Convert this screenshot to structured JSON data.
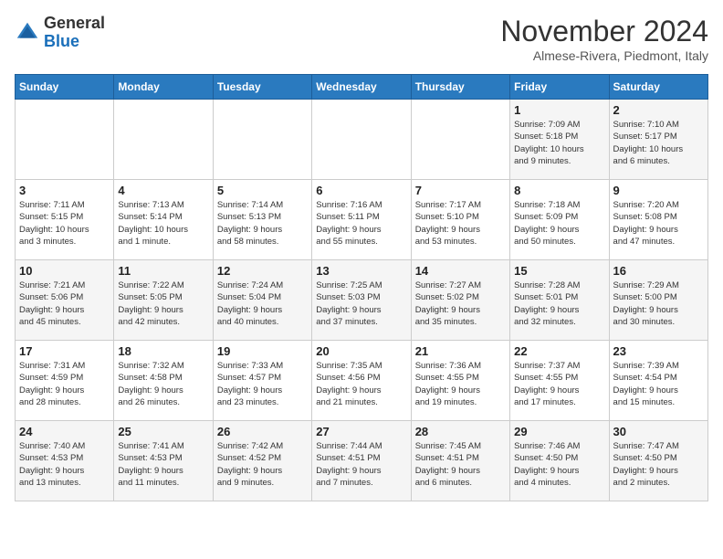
{
  "header": {
    "logo_general": "General",
    "logo_blue": "Blue",
    "month_title": "November 2024",
    "location": "Almese-Rivera, Piedmont, Italy"
  },
  "days_of_week": [
    "Sunday",
    "Monday",
    "Tuesday",
    "Wednesday",
    "Thursday",
    "Friday",
    "Saturday"
  ],
  "weeks": [
    [
      {
        "day": "",
        "info": ""
      },
      {
        "day": "",
        "info": ""
      },
      {
        "day": "",
        "info": ""
      },
      {
        "day": "",
        "info": ""
      },
      {
        "day": "",
        "info": ""
      },
      {
        "day": "1",
        "info": "Sunrise: 7:09 AM\nSunset: 5:18 PM\nDaylight: 10 hours\nand 9 minutes."
      },
      {
        "day": "2",
        "info": "Sunrise: 7:10 AM\nSunset: 5:17 PM\nDaylight: 10 hours\nand 6 minutes."
      }
    ],
    [
      {
        "day": "3",
        "info": "Sunrise: 7:11 AM\nSunset: 5:15 PM\nDaylight: 10 hours\nand 3 minutes."
      },
      {
        "day": "4",
        "info": "Sunrise: 7:13 AM\nSunset: 5:14 PM\nDaylight: 10 hours\nand 1 minute."
      },
      {
        "day": "5",
        "info": "Sunrise: 7:14 AM\nSunset: 5:13 PM\nDaylight: 9 hours\nand 58 minutes."
      },
      {
        "day": "6",
        "info": "Sunrise: 7:16 AM\nSunset: 5:11 PM\nDaylight: 9 hours\nand 55 minutes."
      },
      {
        "day": "7",
        "info": "Sunrise: 7:17 AM\nSunset: 5:10 PM\nDaylight: 9 hours\nand 53 minutes."
      },
      {
        "day": "8",
        "info": "Sunrise: 7:18 AM\nSunset: 5:09 PM\nDaylight: 9 hours\nand 50 minutes."
      },
      {
        "day": "9",
        "info": "Sunrise: 7:20 AM\nSunset: 5:08 PM\nDaylight: 9 hours\nand 47 minutes."
      }
    ],
    [
      {
        "day": "10",
        "info": "Sunrise: 7:21 AM\nSunset: 5:06 PM\nDaylight: 9 hours\nand 45 minutes."
      },
      {
        "day": "11",
        "info": "Sunrise: 7:22 AM\nSunset: 5:05 PM\nDaylight: 9 hours\nand 42 minutes."
      },
      {
        "day": "12",
        "info": "Sunrise: 7:24 AM\nSunset: 5:04 PM\nDaylight: 9 hours\nand 40 minutes."
      },
      {
        "day": "13",
        "info": "Sunrise: 7:25 AM\nSunset: 5:03 PM\nDaylight: 9 hours\nand 37 minutes."
      },
      {
        "day": "14",
        "info": "Sunrise: 7:27 AM\nSunset: 5:02 PM\nDaylight: 9 hours\nand 35 minutes."
      },
      {
        "day": "15",
        "info": "Sunrise: 7:28 AM\nSunset: 5:01 PM\nDaylight: 9 hours\nand 32 minutes."
      },
      {
        "day": "16",
        "info": "Sunrise: 7:29 AM\nSunset: 5:00 PM\nDaylight: 9 hours\nand 30 minutes."
      }
    ],
    [
      {
        "day": "17",
        "info": "Sunrise: 7:31 AM\nSunset: 4:59 PM\nDaylight: 9 hours\nand 28 minutes."
      },
      {
        "day": "18",
        "info": "Sunrise: 7:32 AM\nSunset: 4:58 PM\nDaylight: 9 hours\nand 26 minutes."
      },
      {
        "day": "19",
        "info": "Sunrise: 7:33 AM\nSunset: 4:57 PM\nDaylight: 9 hours\nand 23 minutes."
      },
      {
        "day": "20",
        "info": "Sunrise: 7:35 AM\nSunset: 4:56 PM\nDaylight: 9 hours\nand 21 minutes."
      },
      {
        "day": "21",
        "info": "Sunrise: 7:36 AM\nSunset: 4:55 PM\nDaylight: 9 hours\nand 19 minutes."
      },
      {
        "day": "22",
        "info": "Sunrise: 7:37 AM\nSunset: 4:55 PM\nDaylight: 9 hours\nand 17 minutes."
      },
      {
        "day": "23",
        "info": "Sunrise: 7:39 AM\nSunset: 4:54 PM\nDaylight: 9 hours\nand 15 minutes."
      }
    ],
    [
      {
        "day": "24",
        "info": "Sunrise: 7:40 AM\nSunset: 4:53 PM\nDaylight: 9 hours\nand 13 minutes."
      },
      {
        "day": "25",
        "info": "Sunrise: 7:41 AM\nSunset: 4:53 PM\nDaylight: 9 hours\nand 11 minutes."
      },
      {
        "day": "26",
        "info": "Sunrise: 7:42 AM\nSunset: 4:52 PM\nDaylight: 9 hours\nand 9 minutes."
      },
      {
        "day": "27",
        "info": "Sunrise: 7:44 AM\nSunset: 4:51 PM\nDaylight: 9 hours\nand 7 minutes."
      },
      {
        "day": "28",
        "info": "Sunrise: 7:45 AM\nSunset: 4:51 PM\nDaylight: 9 hours\nand 6 minutes."
      },
      {
        "day": "29",
        "info": "Sunrise: 7:46 AM\nSunset: 4:50 PM\nDaylight: 9 hours\nand 4 minutes."
      },
      {
        "day": "30",
        "info": "Sunrise: 7:47 AM\nSunset: 4:50 PM\nDaylight: 9 hours\nand 2 minutes."
      }
    ]
  ]
}
